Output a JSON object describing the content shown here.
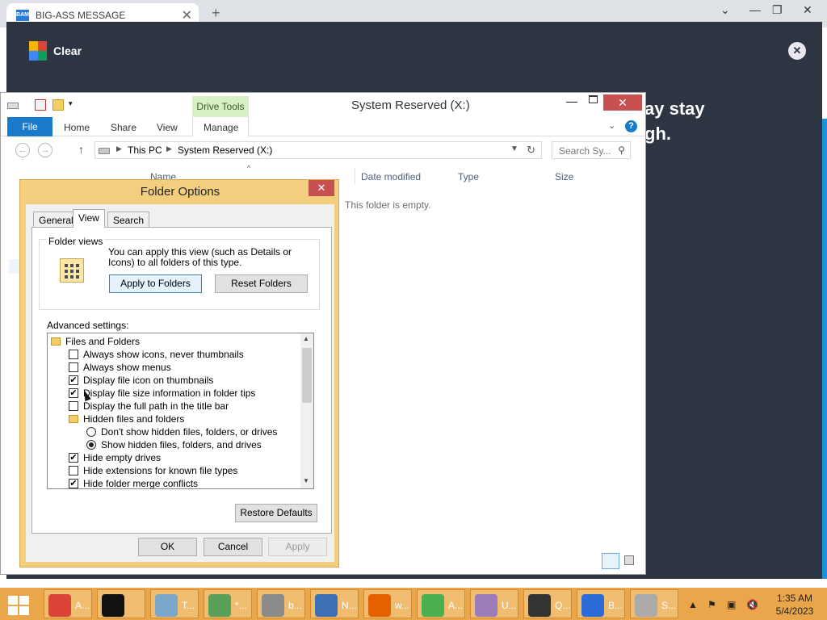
{
  "browser": {
    "tab_title": "BIG-ASS MESSAGE",
    "tab_favicon_text": "BAM",
    "tab_close": "✕",
    "new_tab": "+"
  },
  "webpage": {
    "brand_text": "Clear",
    "close_glyph": "✕",
    "message_line1": "ay stay",
    "message_line2": "gh."
  },
  "explorer": {
    "title": "System Reserved (X:)",
    "contextual_tab": "Drive Tools",
    "ribbon": {
      "file": "File",
      "home": "Home",
      "share": "Share",
      "view": "View",
      "manage": "Manage"
    },
    "help_glyph": "?",
    "breadcrumb": [
      "This PC",
      "System Reserved (X:)"
    ],
    "search_placeholder": "Search Sy...",
    "columns": [
      "Name",
      "Date modified",
      "Type",
      "Size"
    ],
    "empty_message": "This folder is empty.",
    "close_glyph": "✕"
  },
  "dialog": {
    "title": "Folder Options",
    "close_glyph": "✕",
    "tabs": [
      "General",
      "View",
      "Search"
    ],
    "active_tab": "View",
    "folder_views": {
      "legend": "Folder views",
      "description": "You can apply this view (such as Details or Icons) to all folders of this type.",
      "apply_button": "Apply to Folders",
      "reset_button": "Reset Folders"
    },
    "advanced_label": "Advanced settings:",
    "tree": [
      {
        "kind": "folder",
        "indent": 0,
        "label": "Files and Folders"
      },
      {
        "kind": "check",
        "indent": 1,
        "checked": false,
        "label": "Always show icons, never thumbnails"
      },
      {
        "kind": "check",
        "indent": 1,
        "checked": false,
        "label": "Always show menus"
      },
      {
        "kind": "check",
        "indent": 1,
        "checked": true,
        "label": "Display file icon on thumbnails"
      },
      {
        "kind": "check",
        "indent": 1,
        "checked": true,
        "label": "Display file size information in folder tips"
      },
      {
        "kind": "check",
        "indent": 1,
        "checked": false,
        "label": "Display the full path in the title bar"
      },
      {
        "kind": "folder",
        "indent": 1,
        "label": "Hidden files and folders"
      },
      {
        "kind": "radio",
        "indent": 2,
        "selected": false,
        "label": "Don't show hidden files, folders, or drives"
      },
      {
        "kind": "radio",
        "indent": 2,
        "selected": true,
        "label": "Show hidden files, folders, and drives"
      },
      {
        "kind": "check",
        "indent": 1,
        "checked": true,
        "label": "Hide empty drives"
      },
      {
        "kind": "check",
        "indent": 1,
        "checked": false,
        "label": "Hide extensions for known file types"
      },
      {
        "kind": "check",
        "indent": 1,
        "checked": true,
        "label": "Hide folder merge conflicts"
      }
    ],
    "restore_button": "Restore Defaults",
    "ok_button": "OK",
    "cancel_button": "Cancel",
    "apply_button": "Apply"
  },
  "taskbar": {
    "items": [
      {
        "name": "chrome",
        "label": "A...",
        "color": "#db4437"
      },
      {
        "name": "cmd",
        "label": "",
        "color": "#111111"
      },
      {
        "name": "task-manager",
        "label": "T...",
        "color": "#7aa7c7"
      },
      {
        "name": "notepad",
        "label": "*...",
        "color": "#5aa05a"
      },
      {
        "name": "app-b",
        "label": "b...",
        "color": "#8a8a8a"
      },
      {
        "name": "network",
        "label": "N...",
        "color": "#3d6fb5"
      },
      {
        "name": "firefox",
        "label": "w...",
        "color": "#e66000"
      },
      {
        "name": "app-a",
        "label": "A...",
        "color": "#4caf50"
      },
      {
        "name": "paint",
        "label": "U...",
        "color": "#9b7bb8"
      },
      {
        "name": "app-q",
        "label": "Q...",
        "color": "#333333"
      },
      {
        "name": "app-key",
        "label": "B...",
        "color": "#2b6cd6"
      },
      {
        "name": "drive",
        "label": "S...",
        "color": "#aaaaaa"
      }
    ],
    "clock_time": "1:35 AM",
    "clock_date": "5/4/2023"
  }
}
